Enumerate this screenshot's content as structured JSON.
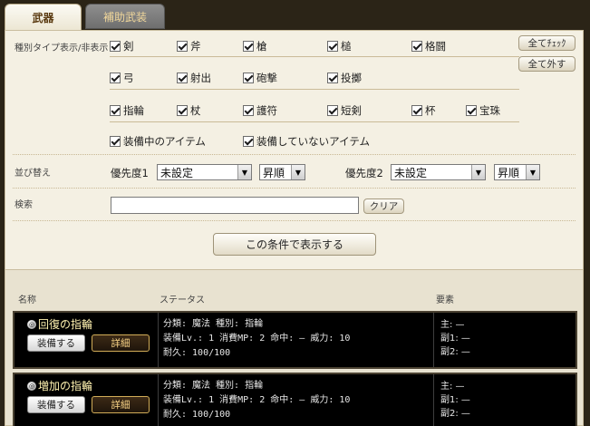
{
  "tabs": {
    "weapons": "武器",
    "aux": "補助武装"
  },
  "filter": {
    "label": "種別タイプ表示/非表示",
    "check_all": "全てﾁｪｯｸ",
    "uncheck_all": "全て外す",
    "types": {
      "sword": "剣",
      "axe": "斧",
      "spear": "槍",
      "hammer": "槌",
      "fist": "格闘",
      "bow": "弓",
      "shooting": "射出",
      "cannon": "砲撃",
      "throw": "投擲",
      "ring": "指輪",
      "staff": "杖",
      "charm": "護符",
      "dagger": "短剣",
      "cup": "杯",
      "jewel": "宝珠"
    },
    "equipped": "装備中のアイテム",
    "not_equipped": "装備していないアイテム"
  },
  "sort": {
    "label": "並び替え",
    "p1_label": "優先度1",
    "p1_value": "未設定",
    "p1_order": "昇順",
    "p2_label": "優先度2",
    "p2_value": "未設定",
    "p2_order": "昇順"
  },
  "search": {
    "label": "検索",
    "value": "",
    "clear": "クリア"
  },
  "submit": "この条件で表示する",
  "list": {
    "col_name": "名称",
    "col_status": "ステータス",
    "col_element": "要素",
    "items": [
      {
        "name": "回復の指輪",
        "equip": "装備する",
        "detail": "詳細",
        "line1": "分類: 魔法 種別: 指輪",
        "line2": "装備Lv.: 1 消費MP: 2 命中: — 威力: 10",
        "line3": "耐久: 100/100",
        "el_main": "主: —",
        "el_sub1": "副1: —",
        "el_sub2": "副2: —"
      },
      {
        "name": "増加の指輪",
        "equip": "装備する",
        "detail": "詳細",
        "line1": "分類: 魔法 種別: 指輪",
        "line2": "装備Lv.: 1 消費MP: 2 命中: — 威力: 10",
        "line3": "耐久: 100/100",
        "el_main": "主: —",
        "el_sub1": "副1: —",
        "el_sub2": "副2: —"
      }
    ]
  }
}
